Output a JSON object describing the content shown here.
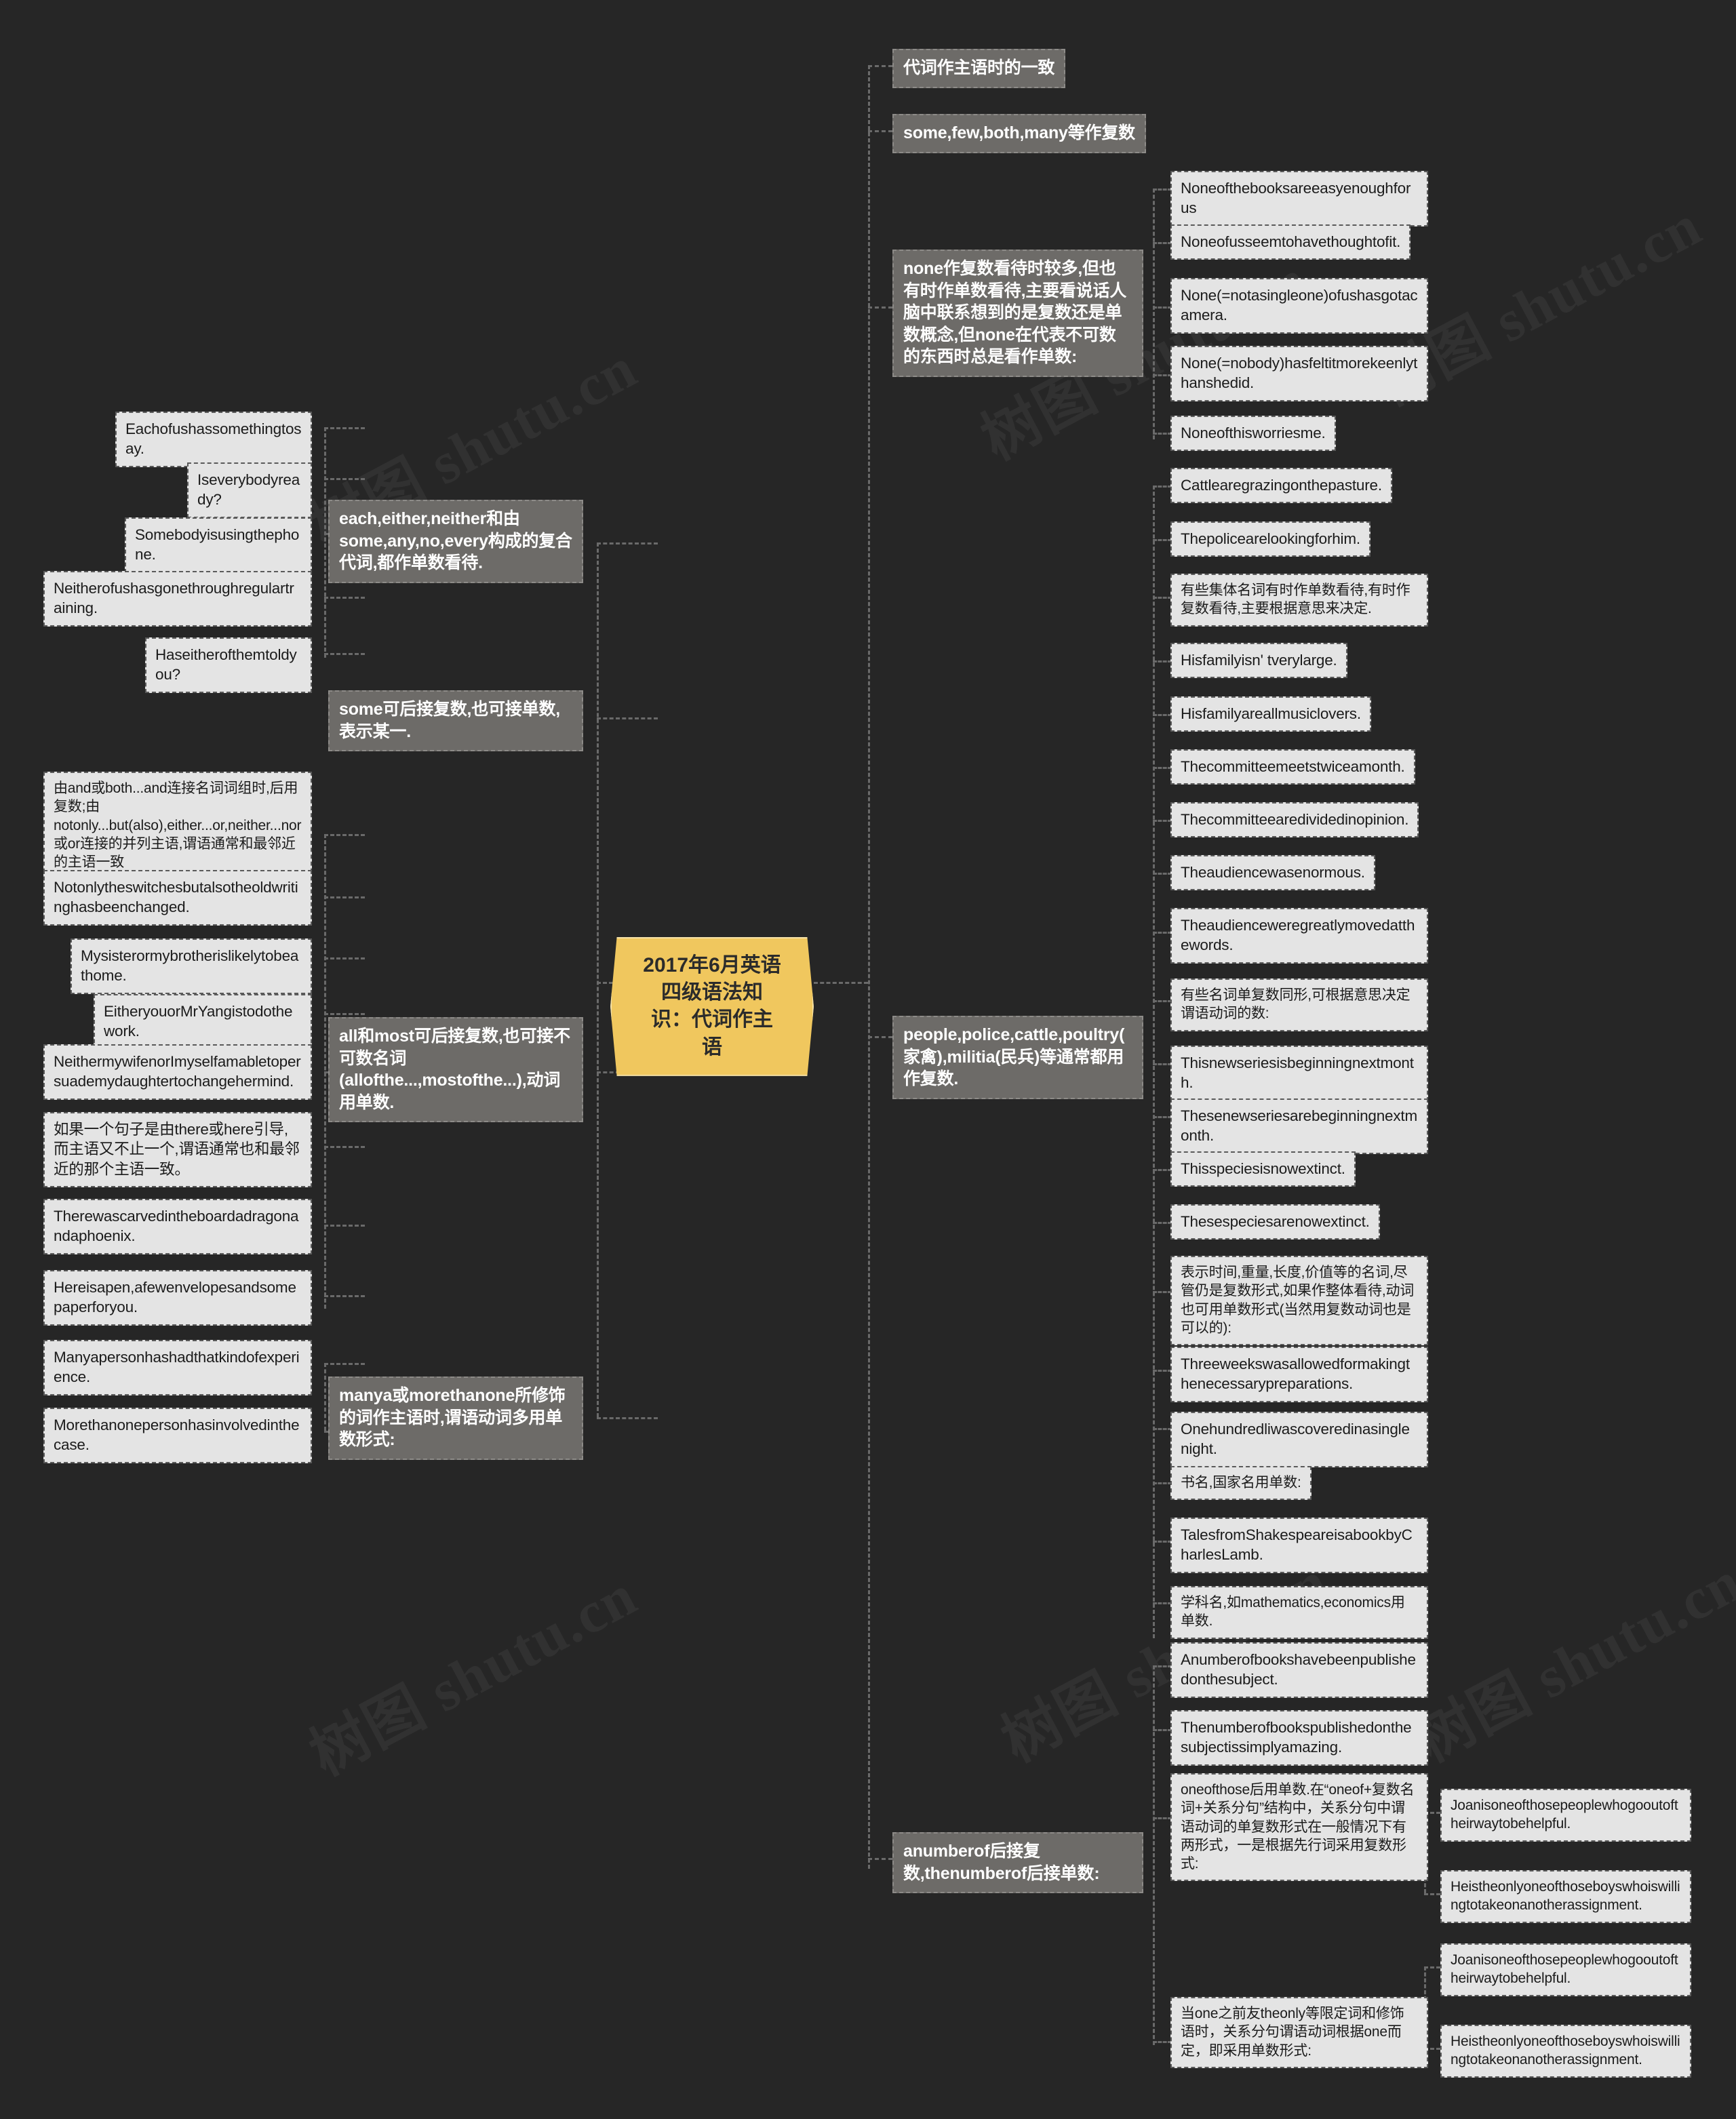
{
  "center": {
    "title": "2017年6月英语四级语法知识：代词作主语",
    "color": "#f0c75e"
  },
  "watermarks": [
    "树图 shutu.cn",
    "树图 shutu.cn",
    "树图 shutu.cn",
    "树图 shutu.cn",
    "树图 shutu.cn",
    "树图 shutu.cn"
  ],
  "theme": {
    "bg": "#262626",
    "branch_fill": "#6d6b68",
    "leaf_fill": "#e4e4e4",
    "line": "#6a6a6a"
  },
  "left": {
    "branches": [
      {
        "label": "each,either,neither和由some,any,no,every构成的复合代词,都作单数看待.",
        "children": [
          "Eachofushassomethingtosay.",
          "Iseverybodyready?",
          "Somebodyisusingthephone.",
          "Neitherofushasgonethroughregulartraining.",
          "Haseitherofthemtoldyou?"
        ]
      },
      {
        "label": "some可后接复数,也可接单数,表示某一.",
        "children": []
      },
      {
        "label": "all和most可后接复数,也可接不可数名词(allofthe...,mostofthe...),动词用单数.",
        "children": [
          "由and或both...and连接名词词组时,后用复数;由notonly...but(also),either...or,neither...nor或or连接的并列主语,谓语通常和最邻近的主语一致",
          "Notonlytheswitchesbutalsotheoldwritinghasbeenchanged.",
          "Mysisterormybrotherislikelytobeathome.",
          "EitheryouorMrYangistodothework.",
          "NeithermywifenorImyselfamabletopersuademydaughtertochangehermind.",
          "如果一个句子是由there或here引导,而主语又不止一个,谓语通常也和最邻近的那个主语一致。",
          "Therewascarvedintheboardadragonandaphoenix.",
          "Hereisapen,afewenvelopesandsomepaperforyou."
        ]
      },
      {
        "label": "manya或morethanone所修饰的词作主语时,谓语动词多用单数形式:",
        "children": [
          "Manyapersonhashadthatkindofexperience.",
          "Morethanonepersonhasinvolvedinthecase."
        ]
      }
    ]
  },
  "right": {
    "branches": [
      {
        "label": "代词作主语时的一致",
        "children": [],
        "grandchildren": []
      },
      {
        "label": "some,few,both,many等作复数",
        "children": [],
        "grandchildren": []
      },
      {
        "label": "none作复数看待时较多,但也有时作单数看待,主要看说话人脑中联系想到的是复数还是单数概念,但none在代表不可数的东西时总是看作单数:",
        "children": [
          "Noneofthebooksareeasyenoughforus",
          "Noneofusseemtohavethoughtofit.",
          "None(=notasingleone)ofushasgotacamera.",
          "None(=nobody)hasfeltitmorekeenlythanshedid.",
          "Noneofthisworriesme."
        ],
        "grandchildren": []
      },
      {
        "label": "people,police,cattle,poultry(家禽),militia(民兵)等通常都用作复数.",
        "children": [
          "Cattlearegrazingonthepasture.",
          "Thepolicearelookingforhim.",
          "有些集体名词有时作单数看待,有时作复数看待,主要根据意思来决定.",
          "Hisfamilyisn'  tverylarge.",
          "Hisfamilyareallmusiclovers.",
          "Thecommitteemeetstwiceamonth.",
          "Thecommitteearedividedinopinion.",
          "Theaudiencewasenormous.",
          "Theaudienceweregreatlymovedatthewords.",
          "有些名词单复数同形,可根据意思决定谓语动词的数:",
          "Thisnewseriesisbeginningnextmonth.",
          "Thesenewseriesarebeginningnextmonth.",
          "Thisspeciesisnowextinct.",
          "Thesespeciesarenowextinct.",
          "表示时间,重量,长度,价值等的名词,尽管仍是复数形式,如果作整体看待,动词也可用单数形式(当然用复数动词也是可以的):",
          "Threeweekswasallowedformakingthenecessarypreparations.",
          "Onehundredliwascoveredinasinglenight.",
          "书名,国家名用单数:",
          "TalesfromShakespeareisabookbyCharlesLamb.",
          "学科名,如mathematics,economics用单数."
        ],
        "grandchildren": []
      },
      {
        "label": "anumberof后接复数,thenumberof后接单数:",
        "children": [
          "Anumberofbookshavebeenpublishedonthesubject.",
          "Thenumberofbookspublishedonthesubjectissimplyamazing.",
          "oneofthose后用单数.在“oneof+复数名词+关系分句”结构中，关系分句中谓语动词的单复数形式在一般情况下有两形式，一是根据先行词采用复数形式:",
          "当one之前友theonly等限定词和修饰语时，关系分句谓语动词根据one而定，即采用单数形式:"
        ],
        "grandchildren": [
          "Joanisoneofthosepeoplewhogooutoftheirwaytobehelpful.",
          "Heistheonlyoneofthoseboyswhoiswillingtotakeonanotherassignment.",
          "Joanisoneofthosepeoplewhogooutoftheirwaytobehelpful.",
          "Heistheonlyoneofthoseboyswhoiswillingtotakeonanotherassignment."
        ]
      }
    ]
  }
}
